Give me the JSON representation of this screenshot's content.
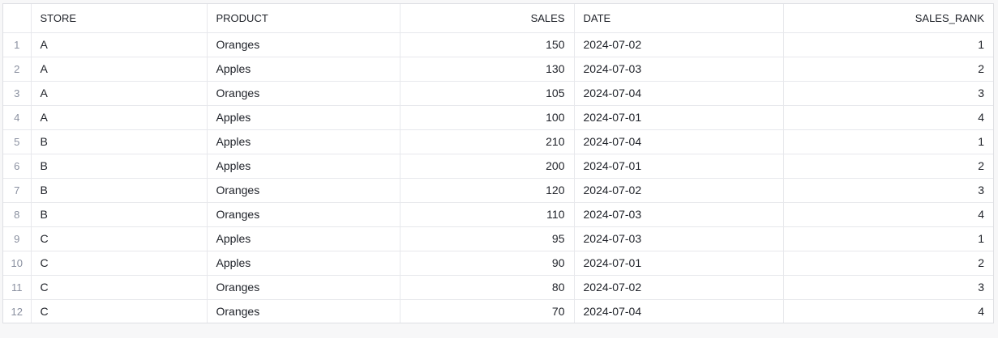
{
  "columns": [
    {
      "key": "STORE",
      "label": "STORE",
      "align": "left"
    },
    {
      "key": "PRODUCT",
      "label": "PRODUCT",
      "align": "left"
    },
    {
      "key": "SALES",
      "label": "SALES",
      "align": "right"
    },
    {
      "key": "DATE",
      "label": "DATE",
      "align": "left"
    },
    {
      "key": "SALES_RANK",
      "label": "SALES_RANK",
      "align": "right"
    }
  ],
  "rows": [
    {
      "num": "1",
      "STORE": "A",
      "PRODUCT": "Oranges",
      "SALES": "150",
      "DATE": "2024-07-02",
      "SALES_RANK": "1"
    },
    {
      "num": "2",
      "STORE": "A",
      "PRODUCT": "Apples",
      "SALES": "130",
      "DATE": "2024-07-03",
      "SALES_RANK": "2"
    },
    {
      "num": "3",
      "STORE": "A",
      "PRODUCT": "Oranges",
      "SALES": "105",
      "DATE": "2024-07-04",
      "SALES_RANK": "3"
    },
    {
      "num": "4",
      "STORE": "A",
      "PRODUCT": "Apples",
      "SALES": "100",
      "DATE": "2024-07-01",
      "SALES_RANK": "4"
    },
    {
      "num": "5",
      "STORE": "B",
      "PRODUCT": "Apples",
      "SALES": "210",
      "DATE": "2024-07-04",
      "SALES_RANK": "1"
    },
    {
      "num": "6",
      "STORE": "B",
      "PRODUCT": "Apples",
      "SALES": "200",
      "DATE": "2024-07-01",
      "SALES_RANK": "2"
    },
    {
      "num": "7",
      "STORE": "B",
      "PRODUCT": "Oranges",
      "SALES": "120",
      "DATE": "2024-07-02",
      "SALES_RANK": "3"
    },
    {
      "num": "8",
      "STORE": "B",
      "PRODUCT": "Oranges",
      "SALES": "110",
      "DATE": "2024-07-03",
      "SALES_RANK": "4"
    },
    {
      "num": "9",
      "STORE": "C",
      "PRODUCT": "Apples",
      "SALES": "95",
      "DATE": "2024-07-03",
      "SALES_RANK": "1"
    },
    {
      "num": "10",
      "STORE": "C",
      "PRODUCT": "Apples",
      "SALES": "90",
      "DATE": "2024-07-01",
      "SALES_RANK": "2"
    },
    {
      "num": "11",
      "STORE": "C",
      "PRODUCT": "Oranges",
      "SALES": "80",
      "DATE": "2024-07-02",
      "SALES_RANK": "3"
    },
    {
      "num": "12",
      "STORE": "C",
      "PRODUCT": "Oranges",
      "SALES": "70",
      "DATE": "2024-07-04",
      "SALES_RANK": "4"
    }
  ]
}
